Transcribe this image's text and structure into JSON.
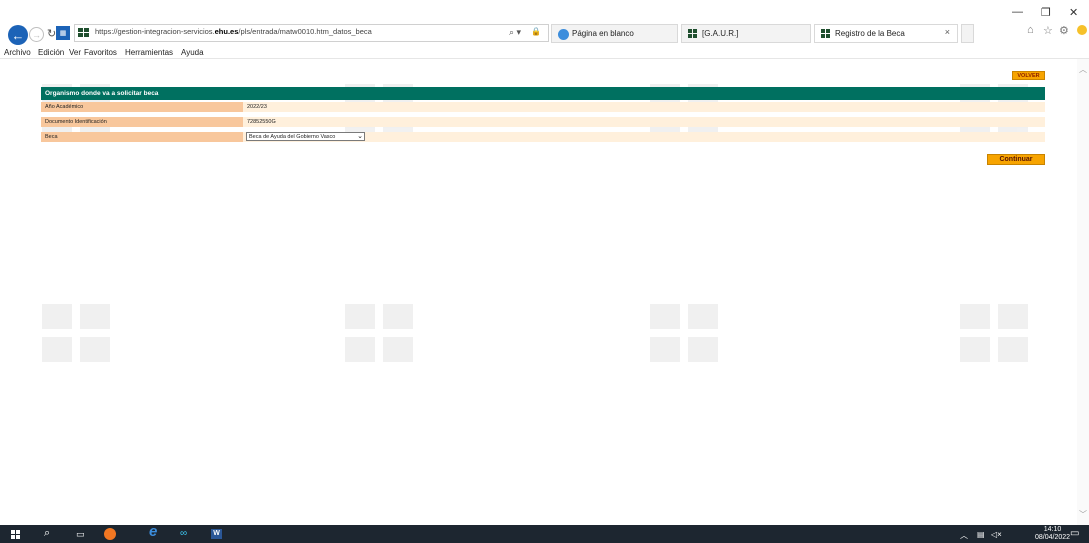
{
  "browser": {
    "url_prefix": "https://gestion-integracion-servicios.",
    "url_domain": "ehu.es",
    "url_path": "/pls/entrada/matw0010.htm_datos_beca",
    "tabs": [
      {
        "label": "Página en blanco"
      },
      {
        "label": "[G.A.U.R.]"
      },
      {
        "label": "Registro de la Beca"
      }
    ],
    "close_tab_glyph": "×",
    "window_controls": {
      "minimize": "—",
      "restore": "❐",
      "close": "✕"
    }
  },
  "menu": {
    "items": [
      "Archivo",
      "Edición",
      "Ver",
      "Favoritos",
      "Herramientas",
      "Ayuda"
    ]
  },
  "page": {
    "volver_label": "VOLVER",
    "section_title": "Organismo donde va a solicitar beca",
    "rows": [
      {
        "label": "Año Académico",
        "value": "2022/23"
      },
      {
        "label": "Documento Identificación",
        "value": "72852550G"
      },
      {
        "label": "Beca",
        "value": ""
      }
    ],
    "beca_select": {
      "selected": "Beca de Ayuda del Gobierno Vasco"
    },
    "continuar_label": "Continuar"
  },
  "taskbar": {
    "time": "14:10",
    "date": "08/04/2022"
  },
  "colors": {
    "header_green": "#007060",
    "label_bg": "#f8c79c",
    "value_bg": "#fff0dc",
    "button_orange": "#f7a400",
    "taskbar": "#1d2630"
  }
}
